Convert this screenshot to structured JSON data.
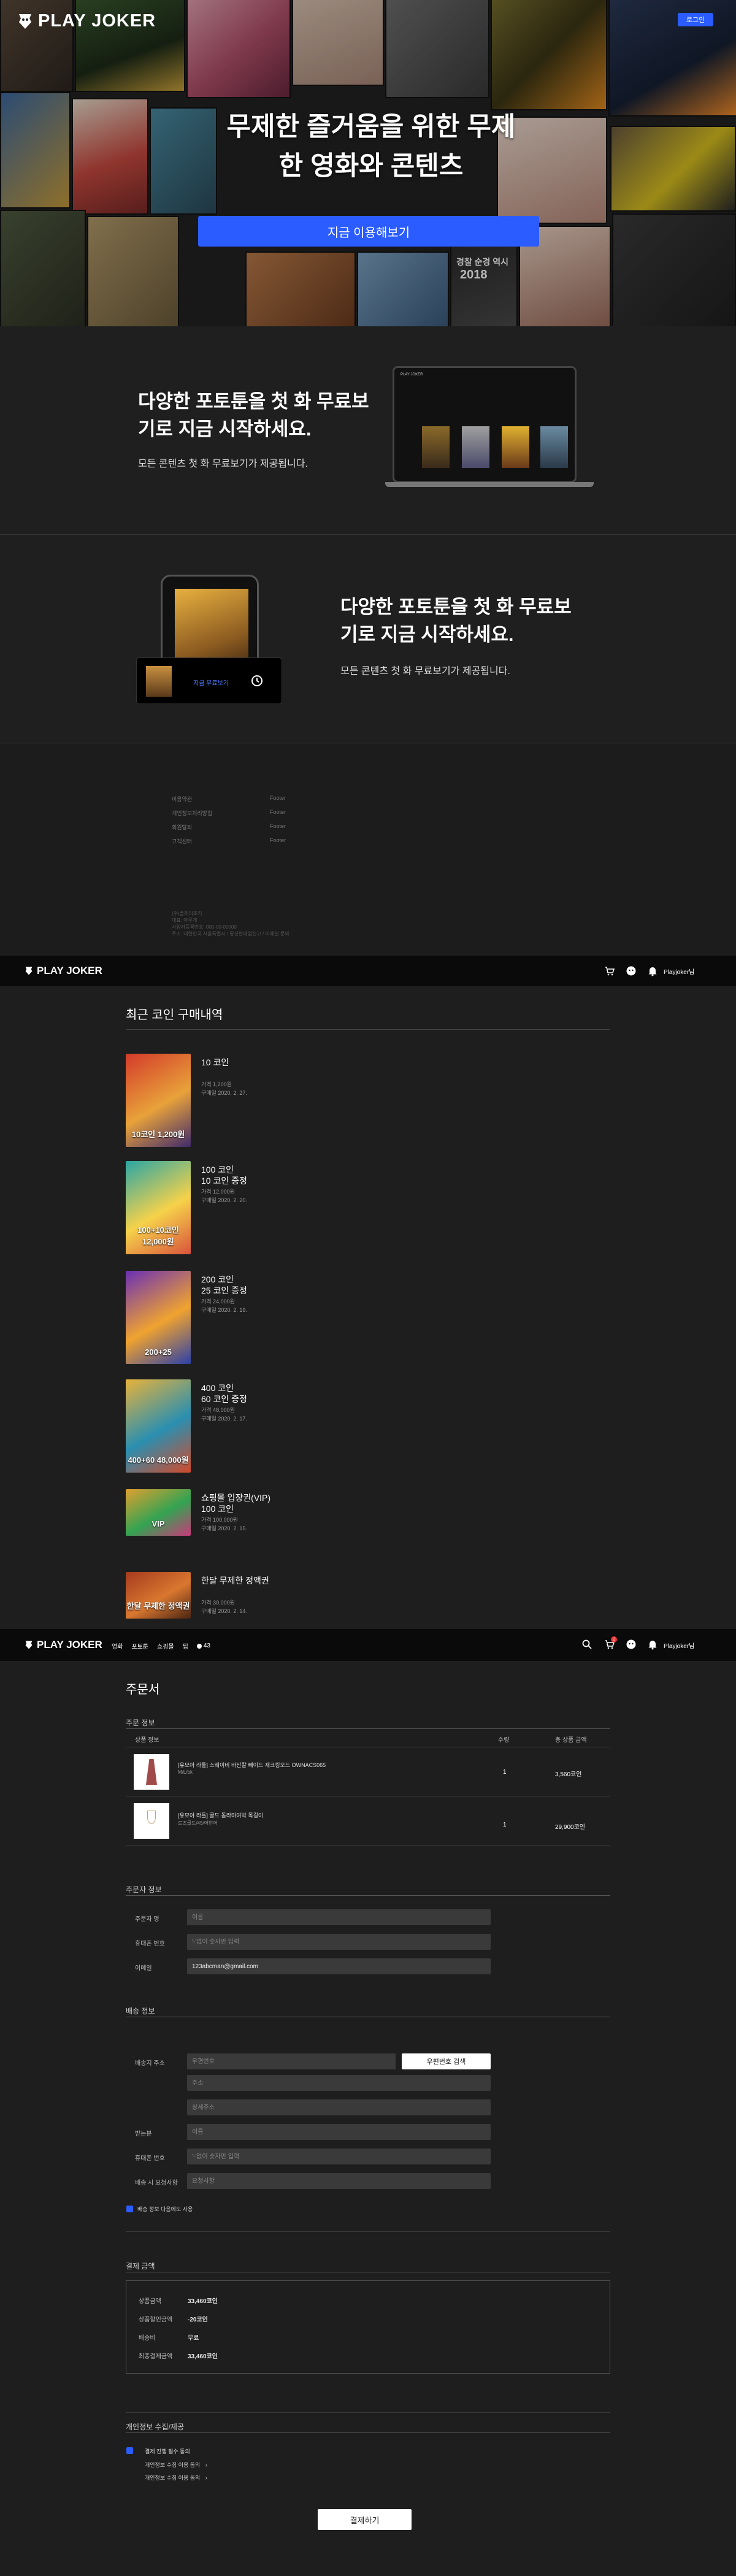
{
  "hero": {
    "logo": "PLAY JOKER",
    "login": "로그인",
    "title_line1": "무제한 즐거움을 위한 무제",
    "title_line2": "한 영화와 콘텐츠",
    "cta": "지금 이용해보기",
    "tile_badge": "2018",
    "tile_caption": "경찰 순경 역시"
  },
  "promo1": {
    "title_line1": "다양한 포토툰을 첫 화 무료보",
    "title_line2": "기로 지금 시작하세요.",
    "sub": "모든 콘텐츠 첫 화 무료보기가 제공됩니다.",
    "device_logo": "PLAY JOKER"
  },
  "promo2": {
    "title_line1": "다양한 포토툰을 첫 화 무료보",
    "title_line2": "기로 지금 시작하세요.",
    "sub": "모든 콘텐츠 첫 화 무료보기가 제공됩니다.",
    "card_label": "지금 무료보기"
  },
  "footer": {
    "left_links": [
      "이용약관",
      "개인정보처리방침",
      "회원탈퇴",
      "고객센터"
    ],
    "right_links": [
      "Footer",
      "Footer",
      "Footer",
      "Footer"
    ],
    "meta": [
      "(주)플레이조커",
      "대표: 아무개",
      "사업자등록번호: 000-00-00000",
      "주소: 대한민국 서울특별시 / 통신판매업신고 / 이메일 문의"
    ]
  },
  "nav1": {
    "logo": "PLAY JOKER",
    "user": "Playjoker님"
  },
  "coin": {
    "heading": "최근 코인 구매내역",
    "items": [
      {
        "title": "10 코인",
        "bonus": "",
        "price": "가격 1,200원",
        "date": "구매일 2020. 2. 27.",
        "thumb_text": "10코인 1,200원",
        "colors": [
          "#d43a2a",
          "#e8a23a",
          "#3f2a6b"
        ]
      },
      {
        "title": "100 코인",
        "bonus": "10 코인 증정",
        "price": "가격 12,000원",
        "date": "구매일 2020. 2. 20.",
        "thumb_text": "100+10코인 12,000원",
        "colors": [
          "#2aa6a4",
          "#f6d24a",
          "#d9533c"
        ]
      },
      {
        "title": "200 코인",
        "bonus": "25 코인 증정",
        "price": "가격 24,000원",
        "date": "구매일 2020. 2. 19.",
        "thumb_text": "200+25",
        "colors": [
          "#6a2fb5",
          "#f0a32f",
          "#2b3fa8"
        ]
      },
      {
        "title": "400 코인",
        "bonus": "60 코인 증정",
        "price": "가격 48,000원",
        "date": "구매일 2020. 2. 17.",
        "thumb_text": "400+60 48,000원",
        "colors": [
          "#e8b33a",
          "#2a8fb0",
          "#d24a2a"
        ]
      },
      {
        "title": "쇼핑몰 입장권(VIP)",
        "bonus": "100 코인",
        "price": "가격 100,000원",
        "date": "구매일 2020. 2. 15.",
        "thumb_text": "VIP",
        "colors": [
          "#e0a02f",
          "#33a352",
          "#c93a7a"
        ]
      },
      {
        "title": "한달 무제한 정액권",
        "bonus": "",
        "price": "가격 30,000원",
        "date": "구매일 2020. 2. 14.",
        "thumb_text": "한달 무제한 정액권",
        "colors": [
          "#a53a1e",
          "#d9772f",
          "#4a2412"
        ]
      }
    ]
  },
  "nav2": {
    "logo": "PLAY JOKER",
    "menu": [
      "영화",
      "포토툰",
      "쇼핑몰",
      "팁"
    ],
    "coin_count": "43",
    "cart_badge": "2",
    "user": "Playjoker님"
  },
  "order": {
    "heading": "주문서",
    "product_section": "주문 정보",
    "cols": {
      "name": "상품 정보",
      "qty": "수량",
      "total": "총 상품 금액"
    },
    "products": [
      {
        "name": "[유모아 라틀] 스웨이비 바틴칼 빼이드 재크킹오드 OWNACS065",
        "sub": "M/L/bk",
        "qty": "1",
        "total": "3,560코인"
      },
      {
        "name": "[유모아 라틀] 골드 돌라마여박 목걸이",
        "sub": "로즈골드/45/어반어",
        "qty": "1",
        "total": "29,900코인"
      }
    ],
    "buyer_section": "주문자 정보",
    "buyer": {
      "name_label": "주문자 명",
      "name_ph": "이름",
      "phone_label": "휴대폰 번호",
      "phone_ph": "'-'없이 숫자만 입력",
      "email_label": "이메일",
      "email_val": "123abcman@gmail.com"
    },
    "ship_section": "배송 정보",
    "ship": {
      "addr_label": "배송지 주소",
      "zip_ph": "우편번호",
      "zip_btn": "우편번호 검색",
      "addr_ph": "주소",
      "addr2_ph": "상세주소",
      "recv_label": "받는분",
      "recv_ph": "이름",
      "phone_label": "휴대폰 번호",
      "phone_ph": "'-'없이 숫자만 입력",
      "req_label": "배송 시 요청사항",
      "req_ph": "요청사항",
      "check": "배송 정보 다음에도 사용"
    },
    "pay_section": "결제 금액",
    "pay": {
      "l1": "상품금액",
      "v1": "33,460코인",
      "l2": "상품할인금액",
      "v2": "-20코인",
      "l3": "배송비",
      "v3": "무료",
      "l4": "최종결제금액",
      "v4": "33,460코인"
    },
    "privacy_section": "개인정보 수집/제공",
    "privacy": {
      "all": "결제 진행 필수 동의",
      "item1": "개인정보 수집 이용 동의",
      "item2": "개인정보 수집 이용 동의"
    },
    "submit": "결제하기"
  }
}
